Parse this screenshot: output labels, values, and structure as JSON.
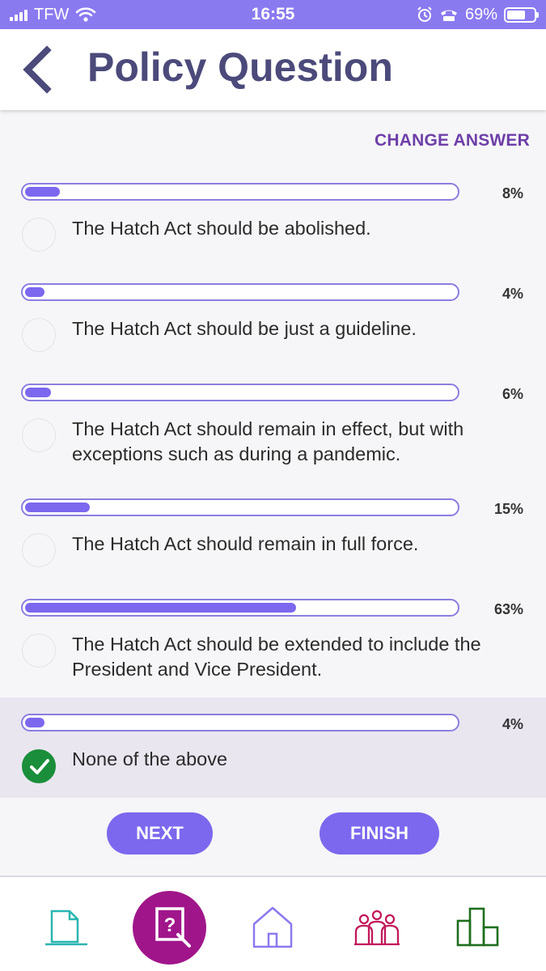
{
  "status_bar": {
    "carrier": "TFW",
    "time": "16:55",
    "battery": "69%"
  },
  "header": {
    "title": "Policy Question"
  },
  "change_answer_label": "CHANGE ANSWER",
  "options": [
    {
      "text": "The Hatch Act should be abolished.",
      "percent_label": "8%",
      "percent": 8,
      "selected": false
    },
    {
      "text": "The Hatch Act should be just a guideline.",
      "percent_label": "4%",
      "percent": 4,
      "selected": false
    },
    {
      "text": "The Hatch Act should remain in effect, but with exceptions such as during a pandemic.",
      "percent_label": "6%",
      "percent": 6,
      "selected": false
    },
    {
      "text": "The Hatch Act should remain in full force.",
      "percent_label": "15%",
      "percent": 15,
      "selected": false
    },
    {
      "text": "The Hatch Act should be extended to include the President and Vice President.",
      "percent_label": "63%",
      "percent": 63,
      "selected": false
    },
    {
      "text": "None of the above",
      "percent_label": "4%",
      "percent": 4,
      "selected": true
    }
  ],
  "buttons": {
    "next": "NEXT",
    "finish": "FINISH"
  },
  "nav": {
    "items": [
      "document-icon",
      "question-search-icon",
      "home-icon",
      "people-icon",
      "chart-icon"
    ],
    "active": "question-search-icon"
  },
  "colors": {
    "accent": "#7b68ee",
    "status_bar": "#8a7af0",
    "title": "#4b4a7a",
    "change_answer": "#6d3fa8",
    "selected_check": "#1a8e3a",
    "nav_active": "#a0168a"
  }
}
